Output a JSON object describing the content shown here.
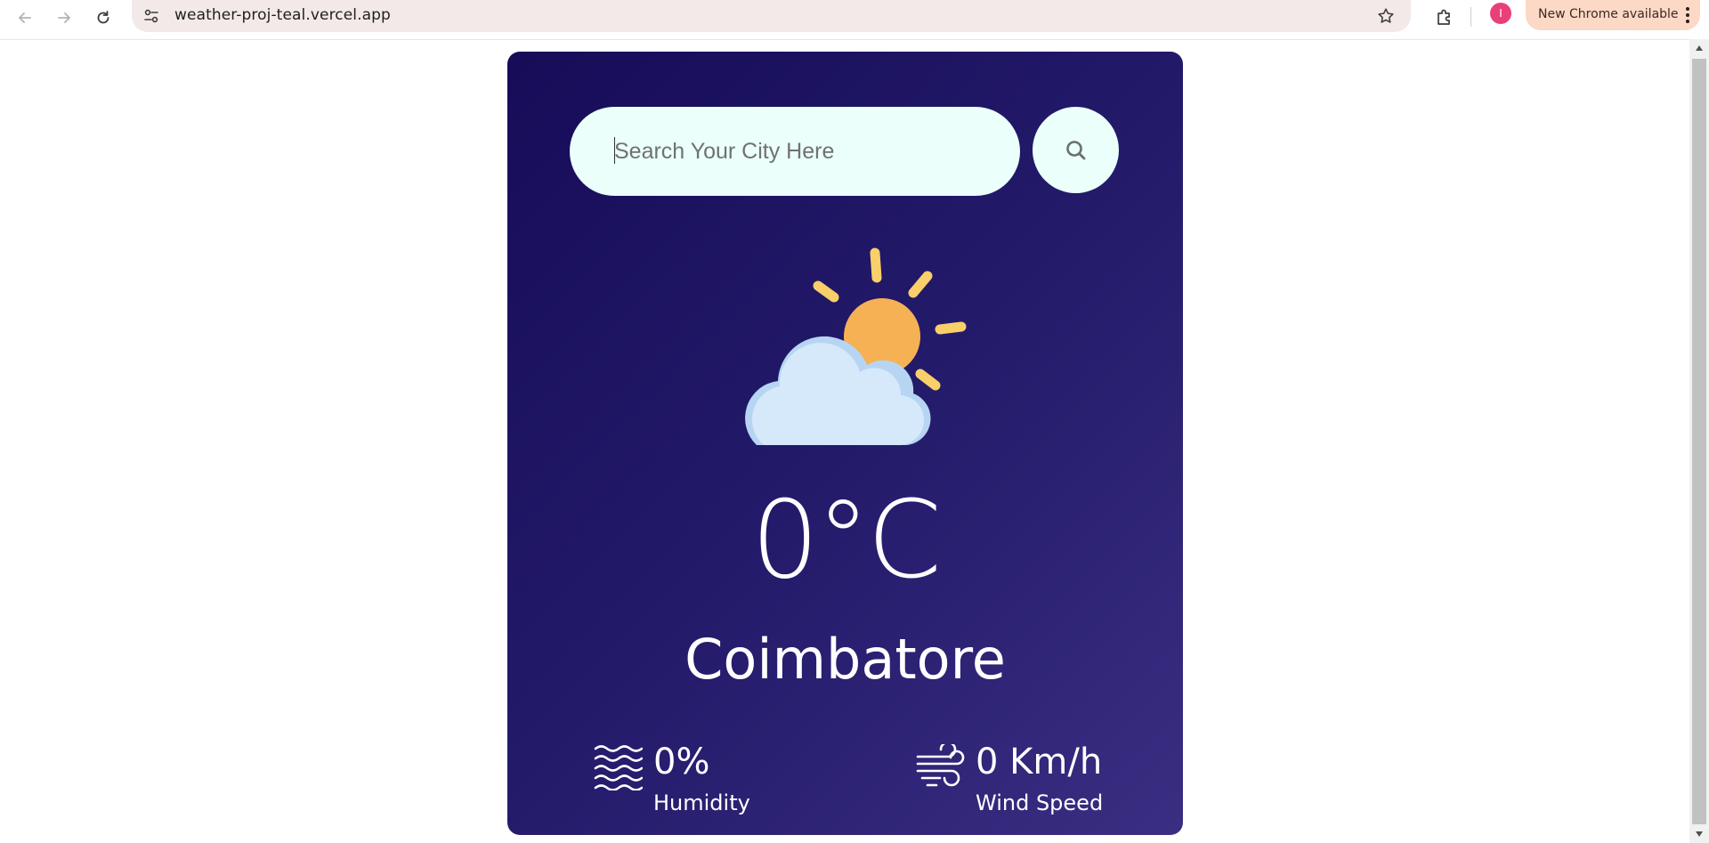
{
  "browser": {
    "url": "weather-proj-teal.vercel.app",
    "avatar_letter": "I",
    "update_label": "New Chrome available"
  },
  "weather": {
    "search": {
      "placeholder": "Search Your City Here",
      "value": ""
    },
    "condition_icon": "partly-cloudy-icon",
    "temperature": "0°C",
    "city": "Coimbatore",
    "humidity": {
      "value": "0%",
      "label": "Humidity",
      "icon": "humidity-waves-icon"
    },
    "wind": {
      "value": "0 Km/h",
      "label": "Wind Speed",
      "icon": "wind-icon"
    }
  },
  "colors": {
    "card_gradient_start": "#160c58",
    "card_gradient_end": "#3a2e82",
    "input_bg": "#ebfffb",
    "sun": "#f5b153",
    "sun_rays": "#f9cf6a",
    "cloud": "#d6e9fb"
  }
}
